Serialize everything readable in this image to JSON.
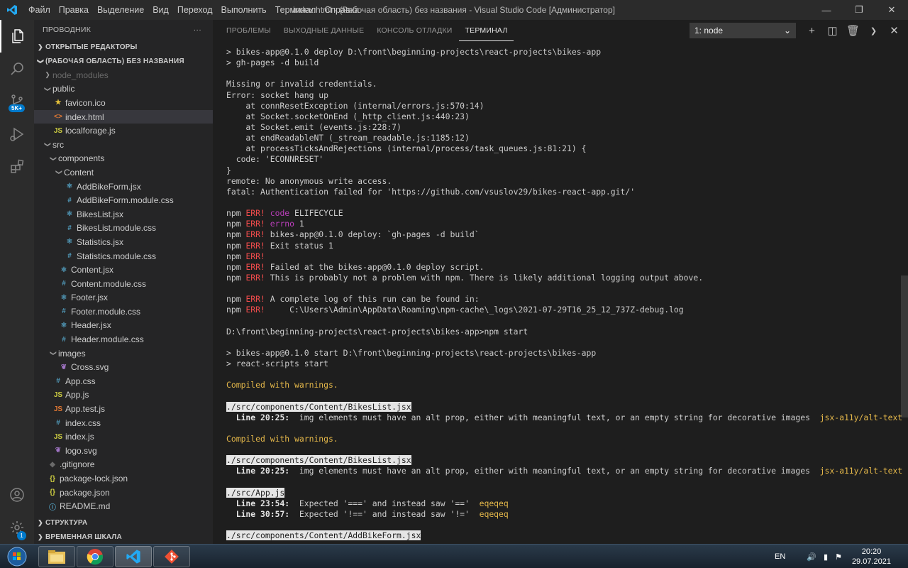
{
  "titlebar": {
    "menu": [
      "Файл",
      "Правка",
      "Выделение",
      "Вид",
      "Переход",
      "Выполнить",
      "Терминал",
      "Справка"
    ],
    "title": "index.html - (Рабочая область) без названия - Visual Studio Code [Администратор]"
  },
  "activitybar": {
    "items": [
      "explorer-icon",
      "search-icon",
      "source-control-icon",
      "run-debug-icon",
      "extensions-icon"
    ],
    "scm_badge": "5K+",
    "settings_badge": "1"
  },
  "sidebar": {
    "header": "ПРОВОДНИК",
    "more": "···",
    "open_editors": "ОТКРЫТЫЕ РЕДАКТОРЫ",
    "workspace": "(РАБОЧАЯ ОБЛАСТЬ) БЕЗ НАЗВАНИЯ",
    "tree": [
      {
        "name": "node_modules",
        "depth": 1,
        "kind": "folder",
        "open": false,
        "dim": true
      },
      {
        "name": "public",
        "depth": 1,
        "kind": "folder",
        "open": true
      },
      {
        "name": "favicon.ico",
        "depth": 2,
        "kind": "ico"
      },
      {
        "name": "index.html",
        "depth": 2,
        "kind": "html",
        "selected": true
      },
      {
        "name": "localforage.js",
        "depth": 2,
        "kind": "js"
      },
      {
        "name": "src",
        "depth": 1,
        "kind": "folder",
        "open": true
      },
      {
        "name": "components",
        "depth": 2,
        "kind": "folder",
        "open": true
      },
      {
        "name": "Content",
        "depth": 3,
        "kind": "folder",
        "open": true
      },
      {
        "name": "AddBikeForm.jsx",
        "depth": 4,
        "kind": "jsx"
      },
      {
        "name": "AddBikeForm.module.css",
        "depth": 4,
        "kind": "css"
      },
      {
        "name": "BikesList.jsx",
        "depth": 4,
        "kind": "jsx"
      },
      {
        "name": "BikesList.module.css",
        "depth": 4,
        "kind": "css"
      },
      {
        "name": "Statistics.jsx",
        "depth": 4,
        "kind": "jsx"
      },
      {
        "name": "Statistics.module.css",
        "depth": 4,
        "kind": "css"
      },
      {
        "name": "Content.jsx",
        "depth": 3,
        "kind": "jsx"
      },
      {
        "name": "Content.module.css",
        "depth": 3,
        "kind": "css"
      },
      {
        "name": "Footer.jsx",
        "depth": 3,
        "kind": "jsx"
      },
      {
        "name": "Footer.module.css",
        "depth": 3,
        "kind": "css"
      },
      {
        "name": "Header.jsx",
        "depth": 3,
        "kind": "jsx"
      },
      {
        "name": "Header.module.css",
        "depth": 3,
        "kind": "css"
      },
      {
        "name": "images",
        "depth": 2,
        "kind": "folder",
        "open": true
      },
      {
        "name": "Cross.svg",
        "depth": 3,
        "kind": "svg"
      },
      {
        "name": "App.css",
        "depth": 2,
        "kind": "css"
      },
      {
        "name": "App.js",
        "depth": 2,
        "kind": "js"
      },
      {
        "name": "App.test.js",
        "depth": 2,
        "kind": "test"
      },
      {
        "name": "index.css",
        "depth": 2,
        "kind": "css"
      },
      {
        "name": "index.js",
        "depth": 2,
        "kind": "js"
      },
      {
        "name": "logo.svg",
        "depth": 2,
        "kind": "svg"
      },
      {
        "name": ".gitignore",
        "depth": 1,
        "kind": "git"
      },
      {
        "name": "package-lock.json",
        "depth": 1,
        "kind": "json"
      },
      {
        "name": "package.json",
        "depth": 1,
        "kind": "json"
      },
      {
        "name": "README.md",
        "depth": 1,
        "kind": "md"
      }
    ],
    "outline": "СТРУКТУРА",
    "timeline": "ВРЕМЕННАЯ ШКАЛА"
  },
  "panel": {
    "tabs": [
      "ПРОБЛЕМЫ",
      "ВЫХОДНЫЕ ДАННЫЕ",
      "КОНСОЛЬ ОТЛАДКИ",
      "ТЕРМИНАЛ"
    ],
    "active_tab": 3,
    "terminal_select": "1: node",
    "actions": [
      "add-terminal-icon",
      "split-terminal-icon",
      "trash-icon",
      "chevron-down-icon",
      "close-icon"
    ]
  },
  "terminal": [
    [
      {
        "t": "> bikes-app@0.1.0 deploy D:\\front\\beginning-projects\\react-projects\\bikes-app"
      }
    ],
    [
      {
        "t": "> gh-pages -d build"
      }
    ],
    [],
    [
      {
        "t": "Missing or invalid credentials."
      }
    ],
    [
      {
        "t": "Error: socket hang up"
      }
    ],
    [
      {
        "t": "    at connResetException (internal/errors.js:570:14)"
      }
    ],
    [
      {
        "t": "    at Socket.socketOnEnd (_http_client.js:440:23)"
      }
    ],
    [
      {
        "t": "    at Socket.emit (events.js:228:7)"
      }
    ],
    [
      {
        "t": "    at endReadableNT (_stream_readable.js:1185:12)"
      }
    ],
    [
      {
        "t": "    at processTicksAndRejections (internal/process/task_queues.js:81:21) {"
      }
    ],
    [
      {
        "t": "  code: 'ECONNRESET'"
      }
    ],
    [
      {
        "t": "}"
      }
    ],
    [
      {
        "t": "remote: No anonymous write access."
      }
    ],
    [
      {
        "t": "fatal: Authentication failed for 'https://github.com/vsuslov29/bikes-react-app.git/'"
      }
    ],
    [],
    [
      {
        "t": "npm "
      },
      {
        "t": "ERR!",
        "c": "err"
      },
      {
        "t": " "
      },
      {
        "t": "code",
        "c": "magenta"
      },
      {
        "t": " ELIFECYCLE"
      }
    ],
    [
      {
        "t": "npm "
      },
      {
        "t": "ERR!",
        "c": "err"
      },
      {
        "t": " "
      },
      {
        "t": "errno",
        "c": "magenta"
      },
      {
        "t": " 1"
      }
    ],
    [
      {
        "t": "npm "
      },
      {
        "t": "ERR!",
        "c": "err"
      },
      {
        "t": " bikes-app@0.1.0 deploy: `gh-pages -d build`"
      }
    ],
    [
      {
        "t": "npm "
      },
      {
        "t": "ERR!",
        "c": "err"
      },
      {
        "t": " Exit status 1"
      }
    ],
    [
      {
        "t": "npm "
      },
      {
        "t": "ERR!",
        "c": "err"
      }
    ],
    [
      {
        "t": "npm "
      },
      {
        "t": "ERR!",
        "c": "err"
      },
      {
        "t": " Failed at the bikes-app@0.1.0 deploy script."
      }
    ],
    [
      {
        "t": "npm "
      },
      {
        "t": "ERR!",
        "c": "err"
      },
      {
        "t": " This is probably not a problem with npm. There is likely additional logging output above."
      }
    ],
    [],
    [
      {
        "t": "npm "
      },
      {
        "t": "ERR!",
        "c": "err"
      },
      {
        "t": " A complete log of this run can be found in:"
      }
    ],
    [
      {
        "t": "npm "
      },
      {
        "t": "ERR!",
        "c": "err"
      },
      {
        "t": "     C:\\Users\\Admin\\AppData\\Roaming\\npm-cache\\_logs\\2021-07-29T16_25_12_737Z-debug.log"
      }
    ],
    [],
    [
      {
        "t": "D:\\front\\beginning-projects\\react-projects\\bikes-app>npm start"
      }
    ],
    [],
    [
      {
        "t": "> bikes-app@0.1.0 start D:\\front\\beginning-projects\\react-projects\\bikes-app"
      }
    ],
    [
      {
        "t": "> react-scripts start"
      }
    ],
    [],
    [
      {
        "t": "Compiled with warnings.",
        "c": "warn"
      }
    ],
    [],
    [
      {
        "t": "./src/components/Content/BikesList.jsx",
        "c": "hl"
      }
    ],
    [
      {
        "t": "  "
      },
      {
        "t": "Line 20:25:",
        "c": "bold"
      },
      {
        "t": "  img elements must have an alt prop, either with meaningful text, or an empty string for decorative images  "
      },
      {
        "t": "jsx-a11y/alt-text",
        "c": "rule"
      }
    ],
    [],
    [
      {
        "t": "Compiled with warnings.",
        "c": "warn"
      }
    ],
    [],
    [
      {
        "t": "./src/components/Content/BikesList.jsx",
        "c": "hl"
      }
    ],
    [
      {
        "t": "  "
      },
      {
        "t": "Line 20:25:",
        "c": "bold"
      },
      {
        "t": "  img elements must have an alt prop, either with meaningful text, or an empty string for decorative images  "
      },
      {
        "t": "jsx-a11y/alt-text",
        "c": "rule"
      }
    ],
    [],
    [
      {
        "t": "./src/App.js",
        "c": "hl"
      }
    ],
    [
      {
        "t": "  "
      },
      {
        "t": "Line 23:54:",
        "c": "bold"
      },
      {
        "t": "  Expected '===' and instead saw '=='  "
      },
      {
        "t": "eqeqeq",
        "c": "rule"
      }
    ],
    [
      {
        "t": "  "
      },
      {
        "t": "Line 30:57:",
        "c": "bold"
      },
      {
        "t": "  Expected '!==' and instead saw '!='  "
      },
      {
        "t": "eqeqeq",
        "c": "rule"
      }
    ],
    [],
    [
      {
        "t": "./src/components/Content/AddBikeForm.jsx",
        "c": "hl"
      }
    ]
  ],
  "taskbar": {
    "apps": [
      "file-explorer-icon",
      "chrome-icon",
      "vscode-icon",
      "git-icon"
    ],
    "lang": "EN",
    "time": "20:20",
    "date": "29.07.2021"
  },
  "colors": {
    "accent": "#007acc",
    "error": "#f14c4c",
    "warning": "#e5b84a"
  }
}
